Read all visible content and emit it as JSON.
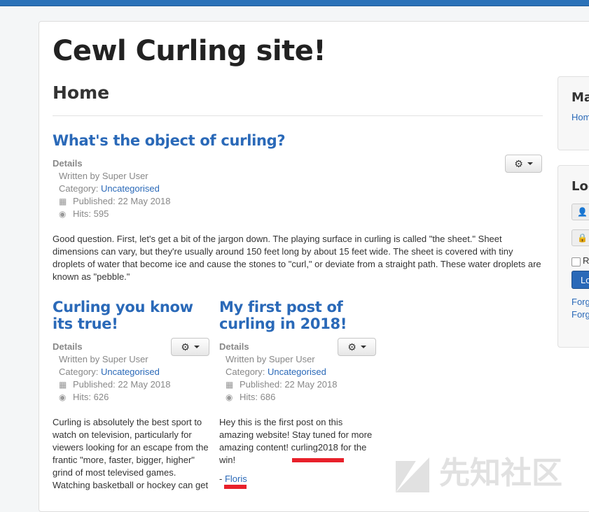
{
  "site": {
    "title": "Cewl Curling site!"
  },
  "page": {
    "heading": "Home"
  },
  "articles": [
    {
      "title": "What's the object of curling?",
      "details_label": "Details",
      "author": "Written by Super User",
      "category_prefix": "Category: ",
      "category": "Uncategorised",
      "published": "Published: 22 May 2018",
      "hits": "Hits: 595",
      "body": "Good question. First, let's get a bit of the jargon down. The playing surface in curling is called \"the sheet.\" Sheet dimensions can vary, but they're usually around 150 feet long by about 15 feet wide. The sheet is covered with tiny droplets of water that become ice and cause the stones to \"curl,\" or deviate from a straight path. These water droplets are known as \"pebble.\""
    },
    {
      "title": "Curling you know its true!",
      "details_label": "Details",
      "author": "Written by Super User",
      "category_prefix": "Category: ",
      "category": "Uncategorised",
      "published": "Published: 22 May 2018",
      "hits": "Hits: 626",
      "body": "Curling is absolutely the best sport to watch on television, particularly for viewers looking for an escape from the frantic \"more, faster, bigger, higher\" grind of most televised games. Watching basketball or hockey can get"
    },
    {
      "title": "My first post of curling in 2018!",
      "details_label": "Details",
      "author": "Written by Super User",
      "category_prefix": "Category: ",
      "category": "Uncategorised",
      "published": "Published: 22 May 2018",
      "hits": "Hits: 686",
      "body": "Hey this is the first post on this amazing website! Stay tuned for more amazing content! curling2018 for the win!",
      "signature_prefix": "- ",
      "signature": "Floris"
    }
  ],
  "sidebar": {
    "menu_heading": "Ma",
    "menu_link": "Hom",
    "login_heading": "Log",
    "remember_label": "R",
    "login_button": "Lo",
    "forgot_1": "Forg",
    "forgot_2": "Forg"
  },
  "watermark": {
    "text": "先知社区"
  },
  "colors": {
    "link": "#2a69b8",
    "topbar": "#2b72b8",
    "highlight": "#e8202a"
  },
  "icons": {
    "options": "gear-icon",
    "published": "calendar-icon",
    "hits": "eye-icon",
    "username": "user-icon",
    "password": "lock-icon"
  }
}
